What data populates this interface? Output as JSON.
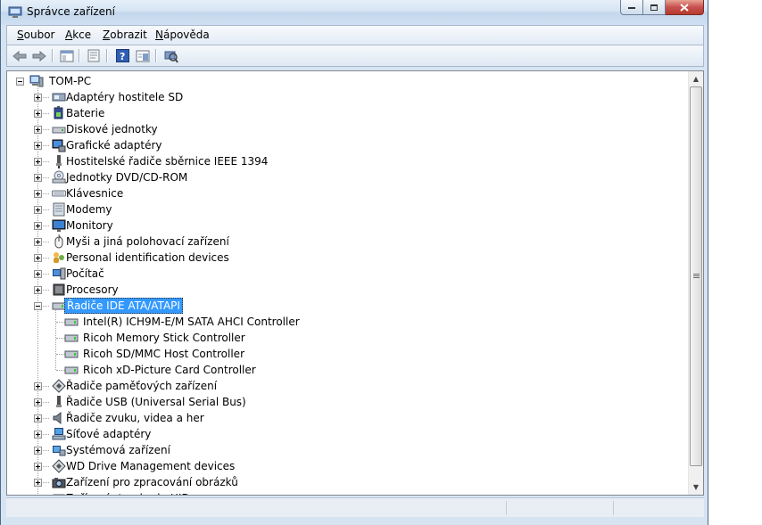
{
  "window": {
    "title": "Správce zařízení"
  },
  "menu": [
    {
      "pre": "",
      "acc": "S",
      "post": "oubor"
    },
    {
      "pre": "",
      "acc": "A",
      "post": "kce"
    },
    {
      "pre": "",
      "acc": "Z",
      "post": "obrazit"
    },
    {
      "pre": "",
      "acc": "N",
      "post": "ápověda"
    }
  ],
  "toolbar": [
    "back-icon",
    "forward-icon",
    "show-hide-tree-icon",
    "properties-icon",
    "help-icon",
    "view-icon",
    "scan-hardware-icon"
  ],
  "tree": {
    "root": "TOM-PC",
    "categories": [
      "Adaptéry hostitele SD",
      "Baterie",
      "Diskové jednotky",
      "Grafické adaptéry",
      "Hostitelské řadiče sběrnice IEEE 1394",
      "Jednotky DVD/CD-ROM",
      "Klávesnice",
      "Modemy",
      "Monitory",
      "Myši a jiná polohovací zařízení",
      "Personal identification devices",
      "Počítač",
      "Procesory",
      "Řadiče IDE ATA/ATAPI",
      "Řadiče paměťových zařízení",
      "Řadiče USB (Universal Serial Bus)",
      "Řadiče zvuku, videa a her",
      "Síťové adaptéry",
      "Systémová zařízení",
      "WD Drive Management devices",
      "Zařízení pro zpracování obrázků",
      "Zařízení standardu HID"
    ],
    "expanded_index": 13,
    "selected": "Řadiče IDE ATA/ATAPI",
    "children": [
      "Intel(R) ICH9M-E/M SATA AHCI Controller",
      "Ricoh Memory Stick Controller",
      "Ricoh SD/MMC Host Controller",
      "Ricoh xD-Picture Card Controller"
    ]
  },
  "colors": {
    "selection": "#3399ff",
    "frame": "#d6e4f2",
    "accent": "#1c5fb5"
  }
}
